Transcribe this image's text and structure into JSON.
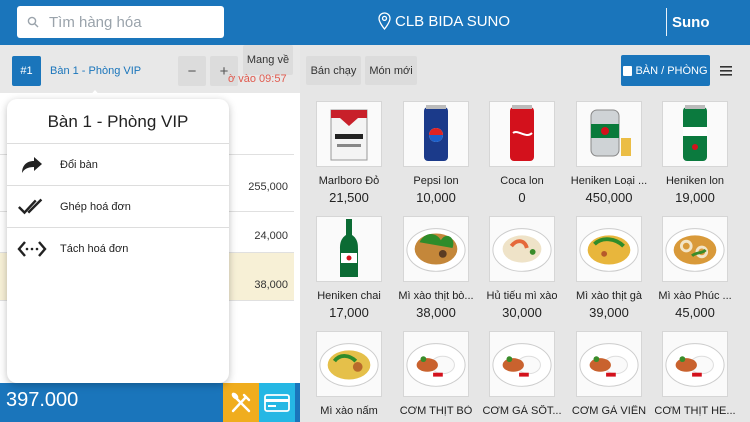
{
  "header": {
    "search_placeholder": "Tìm hàng hóa",
    "store_name": "CLB BIDA SUNO",
    "brand": "Suno"
  },
  "order": {
    "table_no": "#1",
    "table_name": "Bàn 1 - Phòng VIP",
    "minus": "−",
    "plus": "+",
    "takeaway_label": "Mang về",
    "time_note": "ờ vào 09:57",
    "amounts": [
      "255,000",
      "24,000",
      "38,000"
    ],
    "total": "397.000"
  },
  "popup": {
    "title": "Bàn 1 - Phòng VIP",
    "items": [
      {
        "label": "Đổi bàn",
        "icon": "share-arrow-icon"
      },
      {
        "label": "Ghép hoá đơn",
        "icon": "double-check-icon"
      },
      {
        "label": "Tách hoá đơn",
        "icon": "split-arrows-icon"
      }
    ]
  },
  "categories": {
    "best_seller": "Bán chạy",
    "new_items": "Món mới",
    "room_button": "BÀN / PHÒNG"
  },
  "products": [
    {
      "name": "Marlboro Đỏ",
      "price": "21,500",
      "kind": "cigarette"
    },
    {
      "name": "Pepsi lon",
      "price": "10,000",
      "kind": "pepsi"
    },
    {
      "name": "Coca lon",
      "price": "0",
      "kind": "coca"
    },
    {
      "name": "Heniken Loại ...",
      "price": "450,000",
      "kind": "keg"
    },
    {
      "name": "Heniken lon",
      "price": "19,000",
      "kind": "heineken-can"
    },
    {
      "name": "Heniken chai",
      "price": "17,000",
      "kind": "bottle"
    },
    {
      "name": "Mì xào thịt bò...",
      "price": "38,000",
      "kind": "noodle-green"
    },
    {
      "name": "Hủ tiếu mì xào",
      "price": "30,000",
      "kind": "noodle-shrimp"
    },
    {
      "name": "Mì xào thịt gà",
      "price": "39,000",
      "kind": "noodle-yellow"
    },
    {
      "name": "Mì xào Phúc ...",
      "price": "45,000",
      "kind": "noodle-squid"
    },
    {
      "name": "Mì xào nấm",
      "price": "",
      "kind": "rice-dish"
    },
    {
      "name": "CƠM THỊT BÒ",
      "price": "",
      "kind": "rice-plate"
    },
    {
      "name": "CƠM GÀ SỐT...",
      "price": "",
      "kind": "rice-plate"
    },
    {
      "name": "CƠM GÀ VIÊN",
      "price": "",
      "kind": "rice-plate"
    },
    {
      "name": "CƠM THỊT HE...",
      "price": "",
      "kind": "rice-plate"
    }
  ]
}
